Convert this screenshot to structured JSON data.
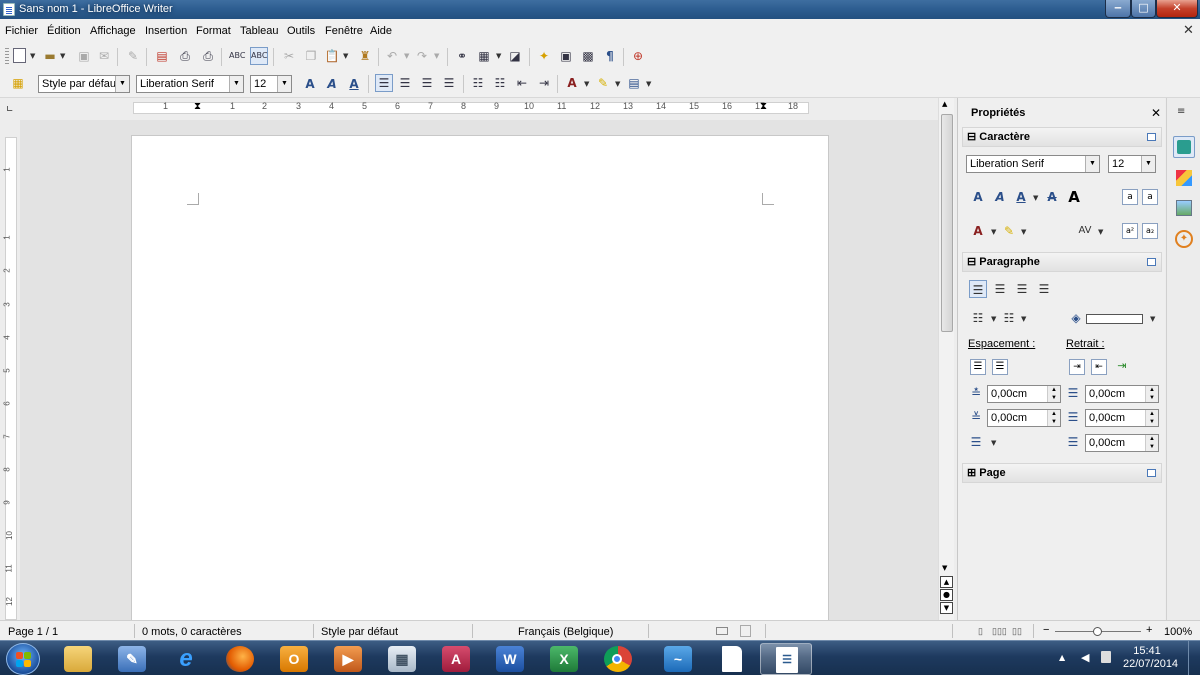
{
  "window": {
    "title": "Sans nom 1 - LibreOffice Writer",
    "minimize": "‒",
    "maximize": "□",
    "close": "✕"
  },
  "menu": {
    "items": [
      "Fichier",
      "Édition",
      "Affichage",
      "Insertion",
      "Format",
      "Tableau",
      "Outils",
      "Fenêtre",
      "Aide"
    ],
    "close": "✕"
  },
  "formatting": {
    "paragraph_style": "Style par défaut",
    "font_name": "Liberation Serif",
    "font_size": "12"
  },
  "ruler": {
    "h_ticks": [
      "1",
      "1",
      "2",
      "3",
      "4",
      "5",
      "6",
      "7",
      "8",
      "9",
      "10",
      "11",
      "12",
      "13",
      "14",
      "15",
      "16",
      "17",
      "18"
    ],
    "v_ticks": [
      "1",
      "1",
      "2",
      "3",
      "4",
      "5",
      "6",
      "7",
      "8",
      "9",
      "10",
      "11",
      "12"
    ]
  },
  "sidebar": {
    "title": "Propriétés",
    "close": "✕",
    "character": {
      "header": "Caractère",
      "font_name": "Liberation Serif",
      "font_size": "12"
    },
    "paragraph": {
      "header": "Paragraphe",
      "spacing_label": "Espacement :",
      "indent_label": "Retrait :",
      "above": "0,00cm",
      "below": "0,00cm",
      "before_text": "0,00cm",
      "after_text": "0,00cm",
      "first_line": "0,00cm"
    },
    "page": {
      "header": "Page"
    }
  },
  "status": {
    "page": "Page 1 / 1",
    "words": "0 mots, 0 caractères",
    "style": "Style par défaut",
    "language": "Français (Belgique)",
    "zoom": "100%",
    "zoom_level": 1.0
  },
  "taskbar": {
    "time": "15:41",
    "date": "22/07/2014"
  },
  "colors": {
    "titlebar": "#2b5b8e",
    "taskbar": "#1e3a5f",
    "accent": "#2b4f8a"
  }
}
